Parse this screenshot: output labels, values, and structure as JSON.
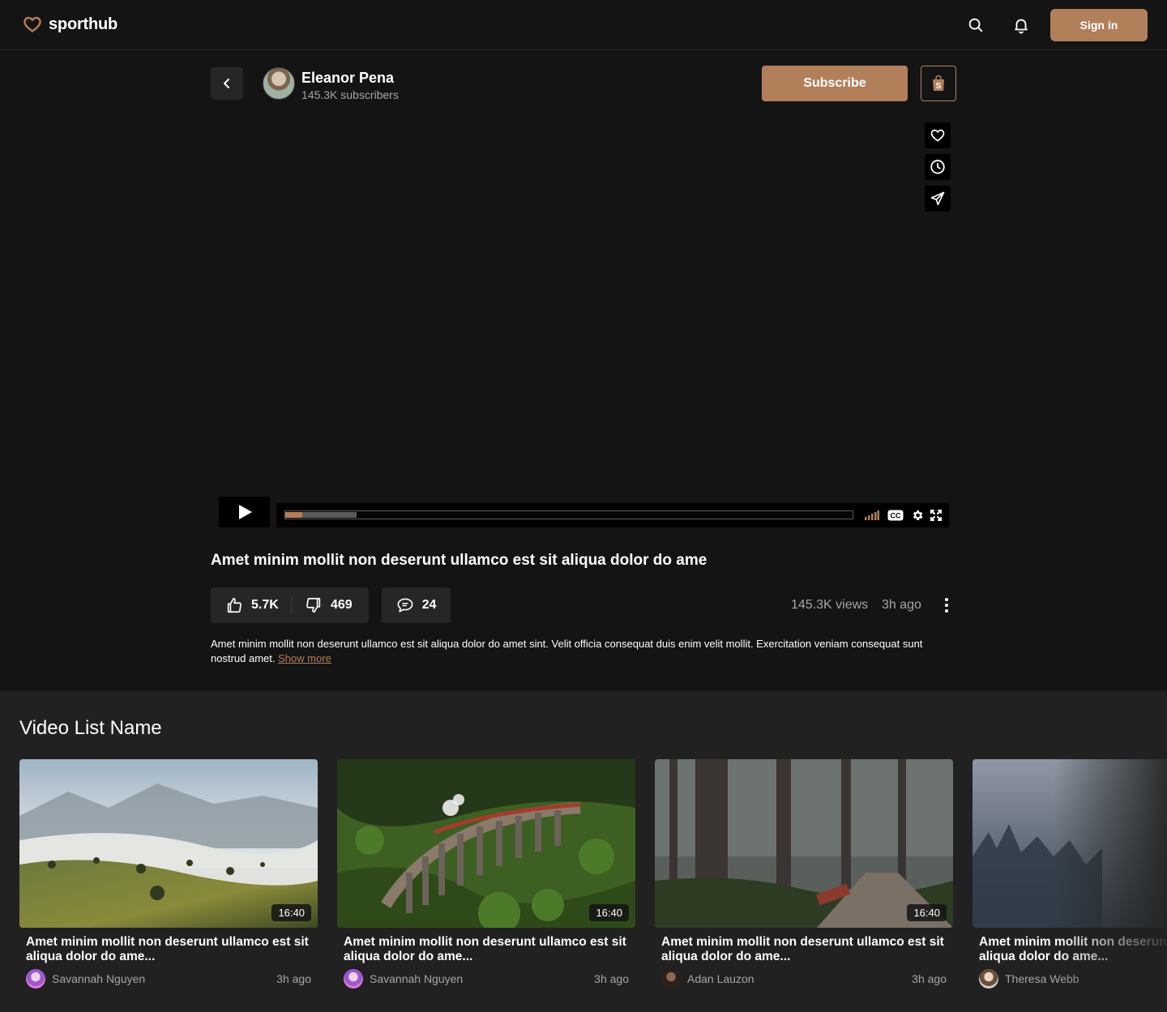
{
  "app": {
    "name": "sporthub",
    "signin_label": "Sign in",
    "accent_color": "#b27f5b"
  },
  "channel": {
    "name": "Eleanor Pena",
    "subscribers": "145.3K subscribers",
    "subscribe_label": "Subscribe"
  },
  "player": {
    "progress_played": 0.03,
    "progress_buffered": 0.125
  },
  "video": {
    "title": "Amet minim mollit non deserunt ullamco est sit aliqua dolor do ame",
    "likes": "5.7K",
    "dislikes": "469",
    "comments": "24",
    "views": "145.3K views",
    "posted": "3h ago",
    "description": "Amet minim mollit non deserunt ullamco est sit aliqua dolor do amet sint. Velit officia consequat duis enim velit mollit. Exercitation veniam consequat sunt nostrud amet.",
    "show_more_label": "Show more"
  },
  "video_list": {
    "title": "Video List Name",
    "items": [
      {
        "title": "Amet minim mollit non deserunt ullamco est sit aliqua dolor do ame...",
        "author": "Savannah Nguyen",
        "posted": "3h ago",
        "duration": "16:40"
      },
      {
        "title": "Amet minim mollit non deserunt ullamco est sit aliqua dolor do ame...",
        "author": "Savannah Nguyen",
        "posted": "3h ago",
        "duration": "16:40"
      },
      {
        "title": "Amet minim mollit non deserunt ullamco est sit aliqua dolor do ame...",
        "author": "Adan Lauzon",
        "posted": "3h ago",
        "duration": "16:40"
      },
      {
        "title": "Amet minim mollit non deserunt ullamco est sit aliqua dolor do ame...",
        "author": "Theresa Webb",
        "posted": "",
        "duration": ""
      }
    ]
  }
}
